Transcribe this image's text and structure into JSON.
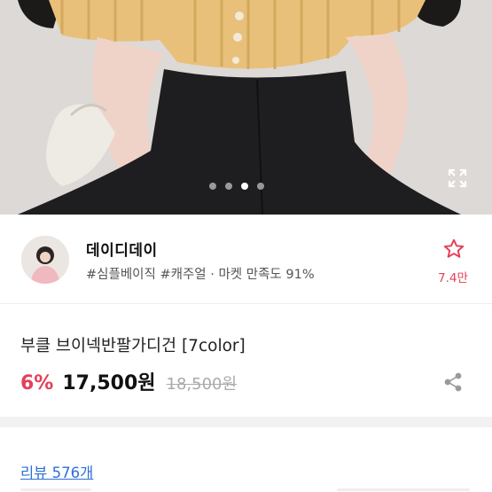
{
  "gallery": {
    "total_slides": 4,
    "active_slide": 3
  },
  "shop": {
    "name": "데이디데이",
    "tags": "#심플베이직 #캐주얼 · 마켓 만족도 91%"
  },
  "favorite": {
    "count": "7.4만"
  },
  "product": {
    "title": "부클 브이넥반팔가디건 [7color]",
    "discount": "6%",
    "price": "17,500원",
    "original_price": "18,500원"
  },
  "reviews": {
    "label": "리뷰 576개"
  },
  "colors": {
    "accent": "#e4405a",
    "link": "#2d6fd6",
    "cardigan": "#e8c07a"
  }
}
